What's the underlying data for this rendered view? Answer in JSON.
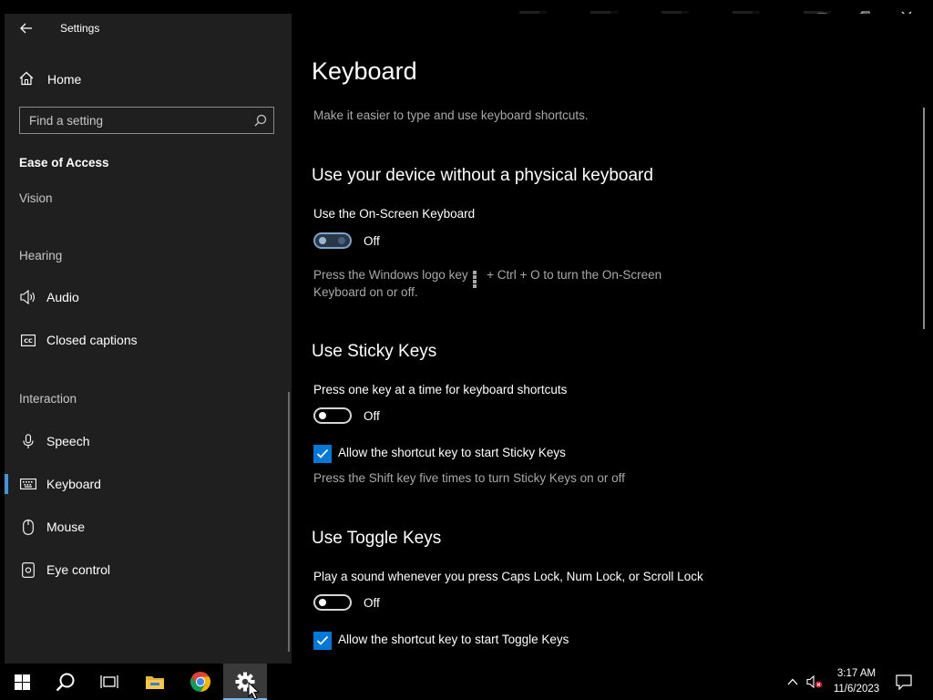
{
  "window": {
    "app_title": "Settings",
    "controls": {
      "minimize": "minimize-icon",
      "restore": "restore-icon",
      "close": "close-icon"
    }
  },
  "sidebar": {
    "home_label": "Home",
    "search": {
      "placeholder": "Find a setting",
      "value": ""
    },
    "section_title": "Ease of Access",
    "groups": [
      {
        "heading": "Vision"
      },
      {
        "heading": "Hearing",
        "items": [
          {
            "label": "Audio",
            "icon": "speaker-icon"
          },
          {
            "label": "Closed captions",
            "icon": "closed-captions-icon"
          }
        ]
      },
      {
        "heading": "Interaction",
        "items": [
          {
            "label": "Speech",
            "icon": "microphone-icon"
          },
          {
            "label": "Keyboard",
            "icon": "keyboard-icon",
            "selected": true
          },
          {
            "label": "Mouse",
            "icon": "mouse-icon"
          },
          {
            "label": "Eye control",
            "icon": "eye-control-icon"
          }
        ]
      }
    ]
  },
  "main": {
    "title": "Keyboard",
    "description": "Make it easier to type and use keyboard shortcuts.",
    "osk": {
      "heading": "Use your device without a physical keyboard",
      "setting_label": "Use the On-Screen Keyboard",
      "toggle_state": "Off",
      "help_before": "Press the Windows logo key",
      "help_after": "+ Ctrl + O to turn the On-Screen Keyboard on or off."
    },
    "sticky": {
      "heading": "Use Sticky Keys",
      "setting_label": "Press one key at a time for keyboard shortcuts",
      "toggle_state": "Off",
      "checkbox_label": "Allow the shortcut key to start Sticky Keys",
      "checkbox_checked": true,
      "help": "Press the Shift key five times to turn Sticky Keys on or off"
    },
    "toggle_keys": {
      "heading": "Use Toggle Keys",
      "setting_label": "Play a sound whenever you press Caps Lock, Num Lock, or Scroll Lock",
      "toggle_state": "Off",
      "checkbox_label": "Allow the shortcut key to start Toggle Keys",
      "checkbox_checked": true
    }
  },
  "taskbar": {
    "apps": [
      "start-icon",
      "search-icon",
      "task-view-icon",
      "file-explorer-icon",
      "chrome-icon",
      "settings-gear-icon"
    ],
    "active_app": "settings-gear-icon",
    "clock_time": "3:17 AM",
    "clock_date": "11/6/2023"
  },
  "colors": {
    "accent": "#0078d7",
    "sidebar_bg": "#1f1f1f",
    "content_bg": "#000000",
    "secondary_text": "#a8a8a8"
  }
}
